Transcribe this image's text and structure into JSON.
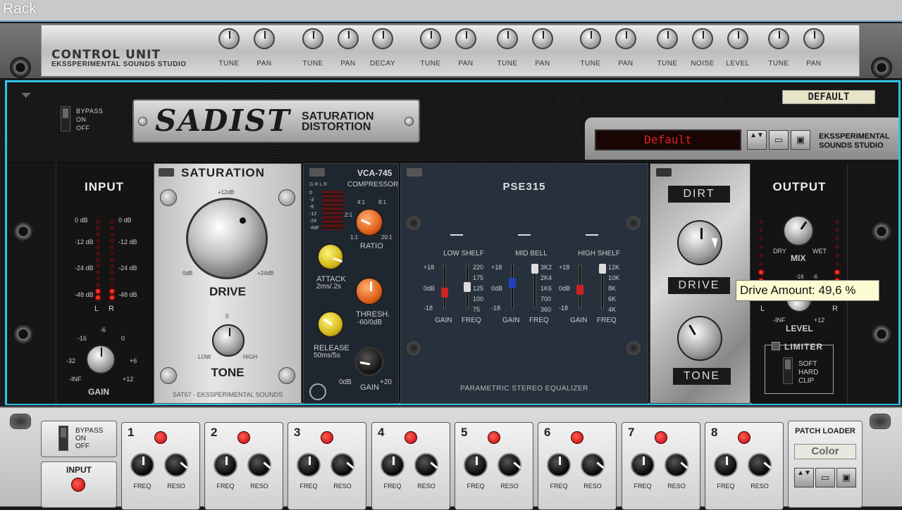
{
  "window": {
    "title": "Rack"
  },
  "control_unit": {
    "title": "CONTROL UNIT",
    "subtitle": "EKSSPERIMENTAL SOUNDS STUDIO",
    "knobs": [
      "TUNE",
      "PAN",
      "TUNE",
      "PAN",
      "DECAY",
      "TUNE",
      "PAN",
      "TUNE",
      "PAN",
      "TUNE",
      "PAN",
      "TUNE",
      "NOISE",
      "LEVEL",
      "TUNE",
      "PAN"
    ]
  },
  "device": {
    "bypass": {
      "bypass": "BYPASS",
      "on": "ON",
      "off": "OFF"
    },
    "logo": {
      "name": "SADIST",
      "line1": "SATURATION",
      "line2": "DISTORTION"
    },
    "patch_tag": "DEFAULT",
    "patch_display": "Default",
    "patch_buttons": {
      "updown": "▲▼",
      "folder": "▭",
      "save": "▣"
    },
    "brand": {
      "line1": "EKSSPERIMENTAL",
      "line2": "SOUNDS STUDIO"
    },
    "colors": {
      "accent": "#2ec4e8",
      "display_text": "#e02020",
      "led_red": "#ff3020"
    },
    "input": {
      "title": "INPUT",
      "scale_left": [
        "0 dB",
        "-12 dB",
        "-24 dB",
        "-48 dB"
      ],
      "scale_right": [
        "0 dB",
        "-12 dB",
        "-24 dB",
        "-48 dB"
      ],
      "lr": [
        "L",
        "R"
      ],
      "gain_scale": [
        "-16",
        "-6",
        "0",
        "-32",
        "+6",
        "-INF",
        "+12"
      ],
      "gain_label": "GAIN"
    },
    "saturation": {
      "title": "SATURATION",
      "drive_max": "+12dB",
      "drive_min": "0dB",
      "drive_max2": "+24dB",
      "drive_label": "DRIVE",
      "tone_zero": "0",
      "tone_low": "LOW",
      "tone_high": "HIGH",
      "tone_label": "TONE",
      "footer": "SAT67 - EKSSPERIMENTAL SOUNDS"
    },
    "compressor": {
      "title": "VCA-745",
      "subtitle": "COMPRESSOR",
      "meter_head": "G.R L R",
      "meter_scale": [
        "0",
        "-3",
        "-6",
        "-12",
        "-24",
        "-INF"
      ],
      "ratio_marks": [
        "4:1",
        "8:1",
        "2:1",
        "1:1",
        "20:1"
      ],
      "ratio_label": "RATIO",
      "attack_label": "ATTACK",
      "attack_range": "2ms/.2s",
      "thresh_label": "THRESH.",
      "thresh_range": "-60/0dB",
      "release_label": "RELEASE",
      "release_range": "50ms/5s",
      "gain_min": "0dB",
      "gain_max": "+20",
      "gain_label": "GAIN"
    },
    "eq": {
      "title": "PSE315",
      "bands": [
        {
          "name": "LOW SHELF",
          "scale": [
            "+18",
            "0dB",
            "-18"
          ],
          "freqs": [
            "220",
            "175",
            "125",
            "100",
            "75"
          ],
          "gain": "GAIN",
          "freq": "FREQ"
        },
        {
          "name": "MID BELL",
          "scale": [
            "+18",
            "0dB",
            "-18"
          ],
          "freqs": [
            "3K2",
            "2K4",
            "1K6",
            "700",
            "360"
          ],
          "gain": "GAIN",
          "freq": "FREQ"
        },
        {
          "name": "HIGH SHELF",
          "scale": [
            "+18",
            "0dB",
            "-18"
          ],
          "freqs": [
            "12K",
            "10K",
            "8K",
            "6K",
            "4K"
          ],
          "gain": "GAIN",
          "freq": "FREQ"
        }
      ],
      "footer": "PARAMETRIC STEREO EQUALIZER"
    },
    "dirt": {
      "title": "DIRT",
      "drive": "DRIVE",
      "tone": "TONE"
    },
    "output": {
      "title": "OUTPUT",
      "dry": "DRY",
      "wet": "WET",
      "mix": "MIX",
      "level_scale": [
        "-16",
        "-6",
        "L",
        "R",
        "-INF",
        "+12"
      ],
      "level_label": "LEVEL",
      "limiter": "LIMITER",
      "soft": "SOFT",
      "hard": "HARD",
      "clip": "CLIP"
    },
    "tooltip": "Drive Amount: 49,6 %"
  },
  "bottom": {
    "bypass": {
      "bypass": "BYPASS",
      "on": "ON",
      "off": "OFF"
    },
    "input_label": "INPUT",
    "channels": [
      {
        "num": "1",
        "freq": "FREQ",
        "reso": "RESO"
      },
      {
        "num": "2",
        "freq": "FREQ",
        "reso": "RESO"
      },
      {
        "num": "3",
        "freq": "FREQ",
        "reso": "RESO"
      },
      {
        "num": "4",
        "freq": "FREQ",
        "reso": "RESO"
      },
      {
        "num": "5",
        "freq": "FREQ",
        "reso": "RESO"
      },
      {
        "num": "6",
        "freq": "FREQ",
        "reso": "RESO"
      },
      {
        "num": "7",
        "freq": "FREQ",
        "reso": "RESO"
      },
      {
        "num": "8",
        "freq": "FREQ",
        "reso": "RESO"
      }
    ],
    "patch_loader": {
      "title": "PATCH LOADER",
      "display": "Color"
    }
  }
}
